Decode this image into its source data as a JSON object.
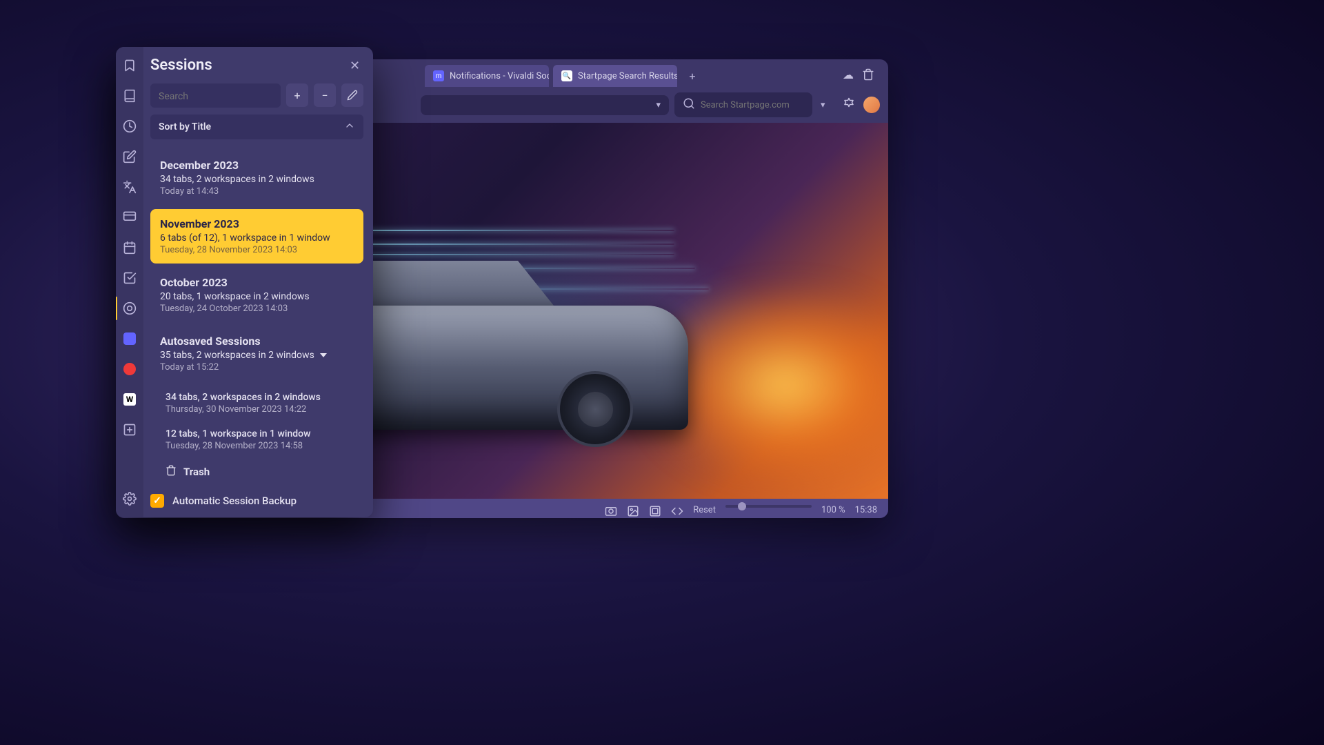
{
  "panel": {
    "title": "Sessions",
    "search_placeholder": "Search",
    "sort_label": "Sort by Title",
    "backup_label": "Automatic Session Backup",
    "backup_checked": true,
    "trash_label": "Trash"
  },
  "sessions": [
    {
      "title": "December 2023",
      "info": "34 tabs, 2 workspaces in 2 windows",
      "date": "Today at 14:43",
      "selected": false
    },
    {
      "title": "November 2023",
      "info": "6 tabs (of 12), 1 workspace in 1 window",
      "date": "Tuesday, 28 November 2023 14:03",
      "selected": true
    },
    {
      "title": "October 2023",
      "info": "20 tabs, 1 workspace in 2 windows",
      "date": "Tuesday, 24 October 2023 14:03",
      "selected": false
    }
  ],
  "autosaved": {
    "title": "Autosaved Sessions",
    "info": "35 tabs, 2 workspaces in 2 windows",
    "date": "Today at 15:22",
    "children": [
      {
        "info": "34 tabs, 2 workspaces in 2 windows",
        "date": "Thursday, 30 November 2023 14:22"
      },
      {
        "info": "12 tabs, 1 workspace in 1 window",
        "date": "Tuesday, 28 November 2023 14:58"
      }
    ]
  },
  "tabs": [
    {
      "label": "Notifications - Vivaldi Soci",
      "favicon": "mastodon"
    },
    {
      "label": "Startpage Search Results",
      "favicon": "startpage"
    }
  ],
  "address": {
    "search_placeholder": "Search Startpage.com"
  },
  "statusbar": {
    "reset_label": "Reset",
    "zoom_label": "100 %",
    "time": "15:38"
  },
  "colors": {
    "panel_bg": "#3f3a6b",
    "accent": "#ffcc33",
    "text": "#e4e1f0"
  }
}
